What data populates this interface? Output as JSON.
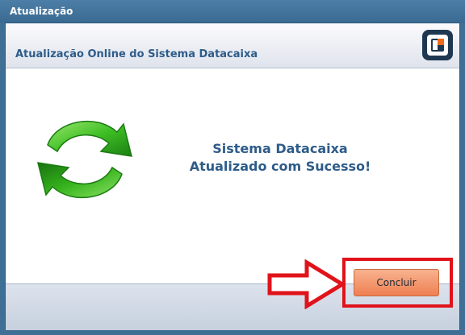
{
  "window": {
    "title": "Atualização"
  },
  "header": {
    "title": "Atualização Online do Sistema Datacaixa",
    "logo_icon": "datacaixa-logo-icon"
  },
  "main": {
    "status_icon": "refresh-arrows-icon",
    "message_line1": "Sistema Datacaixa",
    "message_line2": "Atualizado com Sucesso!"
  },
  "footer": {
    "annotation_icon": "red-arrow-annotation-icon",
    "concluir_label": "Concluir"
  },
  "colors": {
    "titlebar": "#3f6f95",
    "heading_text": "#2e5c8a",
    "button": "#f28f62",
    "annotation_red": "#e0131b",
    "logo_orange": "#f26a1b",
    "icon_green": "#35b01e"
  }
}
